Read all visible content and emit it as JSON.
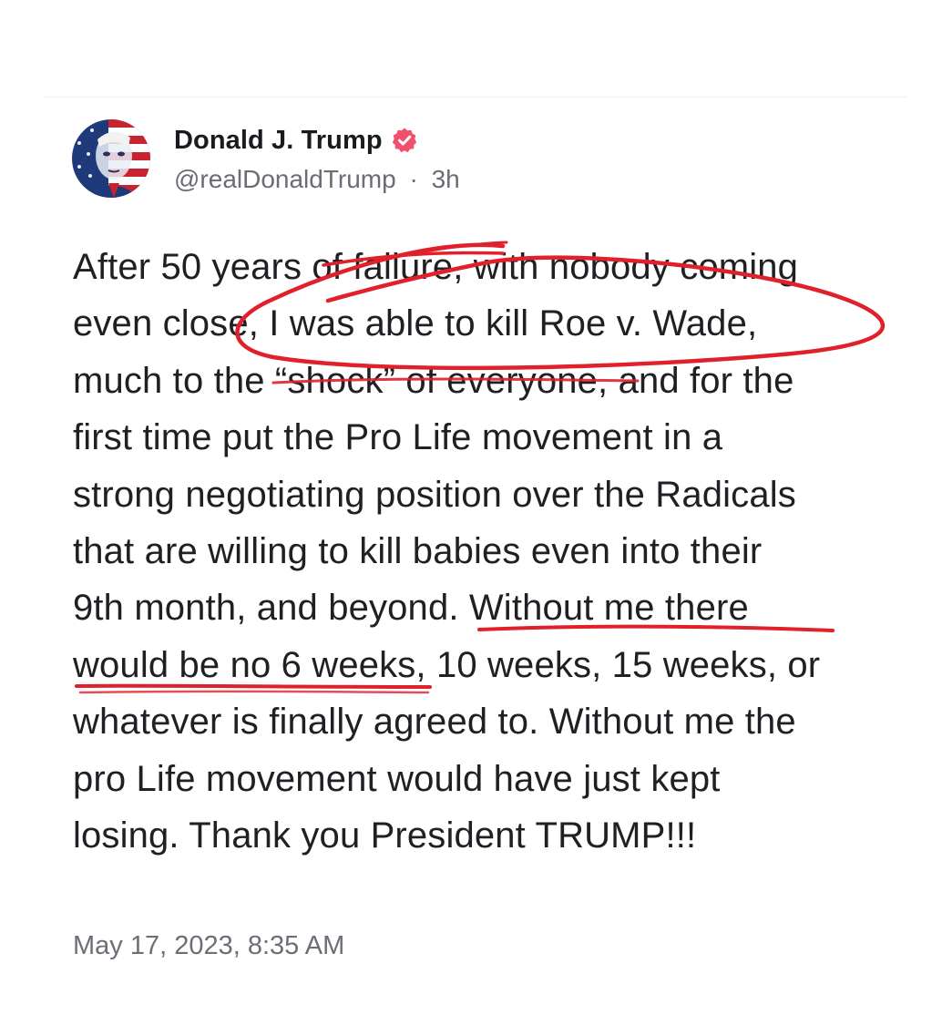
{
  "author": {
    "display_name": "Donald J. Trump",
    "handle": "@realDonaldTrump",
    "separator": "·",
    "relative_time": "3h",
    "verified_badge": "verified-badge-icon",
    "avatar": "avatar-image-flag-portrait"
  },
  "post": {
    "lines": [
      "After 50 years of failure, with nobody coming",
      "even close, I was able to kill Roe v. Wade,",
      "much to the “shock” of everyone, and for the",
      "first time put the Pro Life movement in a",
      "strong negotiating position over the Radicals",
      "that are willing to kill babies even into their",
      "9th month, and beyond. Without me there",
      "would be no 6 weeks, 10 weeks, 15 weeks, or",
      "whatever is finally agreed to. Without me the",
      "pro Life movement would have just kept",
      "losing. Thank you President TRUMP!!!"
    ]
  },
  "timestamp": "May 17, 2023, 8:35 AM",
  "colors": {
    "annotation_red": "#e0202a",
    "verified_badge": "#f0506b",
    "text_primary": "#1f1f24",
    "text_secondary": "#6b6c74"
  }
}
